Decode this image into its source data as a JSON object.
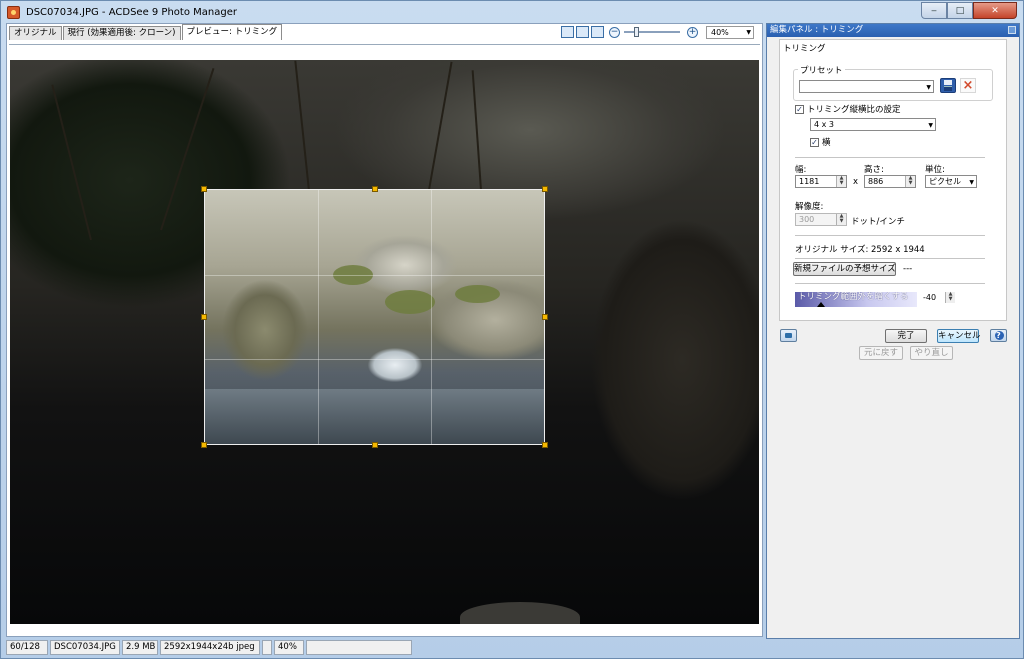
{
  "window": {
    "title": "DSC07034.JPG - ACDSee 9 Photo Manager",
    "controls": {
      "minimize": "‒",
      "maximize": "□",
      "close": "✕"
    }
  },
  "viewer": {
    "tabs": [
      {
        "label": "オリジナル",
        "active": false
      },
      {
        "label": "現行 (効果適用後: クローン)",
        "active": false
      },
      {
        "label": "プレビュー: トリミング",
        "active": true
      }
    ],
    "zoom": {
      "minus": "−",
      "plus": "+",
      "value": "40%",
      "slider_fraction": 0.2
    }
  },
  "panel": {
    "header": "編集パネル : トリミング",
    "group_title": "トリミング",
    "preset": {
      "legend": "プリセット",
      "selected": ""
    },
    "aspect_checkbox": {
      "label": "トリミング縦横比の設定",
      "checked": true
    },
    "aspect_ratio": "4 x 3",
    "landscape_checkbox": {
      "label": "横",
      "checked": true
    },
    "width_label": "幅:",
    "width_value": "1181",
    "times": "x",
    "height_label": "高さ:",
    "height_value": "886",
    "unit_label": "単位:",
    "unit_value": "ピクセル",
    "resolution_label": "解像度:",
    "resolution_value": "300",
    "resolution_unit": "ドット/インチ",
    "original_size": "オリジナル サイズ: 2592 x 1944",
    "estimate_button": "新規ファイルの予想サイズ",
    "estimate_value": "---",
    "darken_label": "トリミング範囲外を暗くする",
    "darken_value": "-40",
    "done_button": "完了",
    "cancel_button": "キャンセル",
    "help_button": "?",
    "undo_button": "元に戻す",
    "redo_button": "やり直し"
  },
  "statusbar": {
    "index": "60/128",
    "filename": "DSC07034.JPG",
    "filesize": "2.9 MB",
    "dimensions": "2592x1944x24b jpeg",
    "zoom": "40%"
  },
  "colors": {
    "handle": "#f5b800",
    "panel_header": "#2a5fb0",
    "accent": "#3c7fb1"
  }
}
